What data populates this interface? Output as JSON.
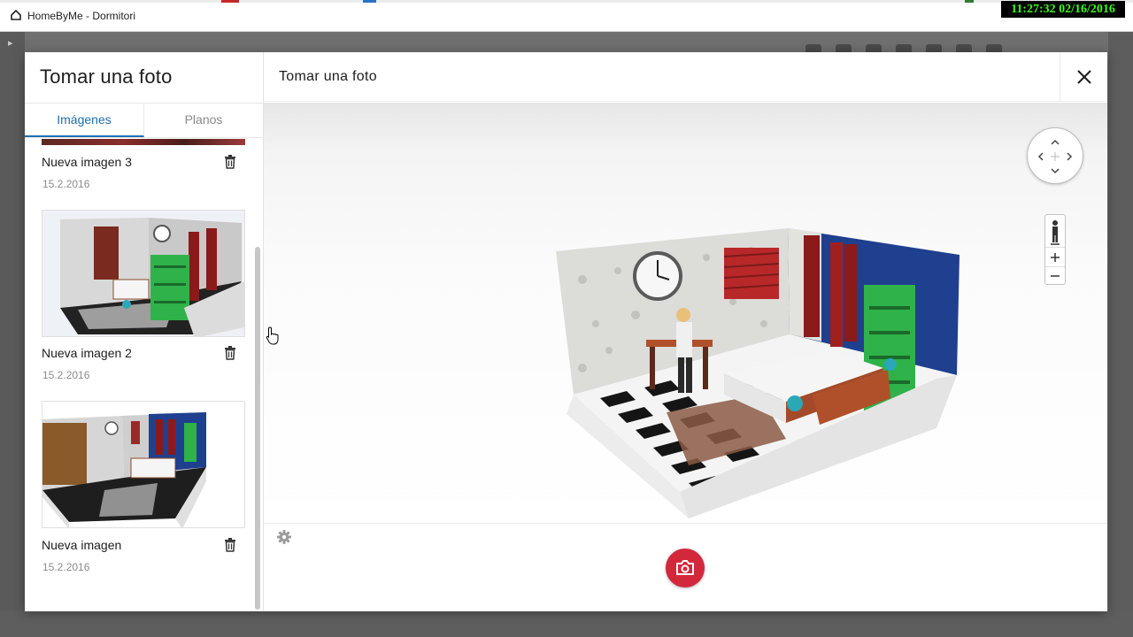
{
  "window": {
    "title": "HomeByMe - Dormitori",
    "clock": "11:27:32  02/16/2016"
  },
  "left_panel": {
    "title": "Tomar una foto",
    "tabs": [
      {
        "label": "Imágenes",
        "active": true
      },
      {
        "label": "Planos",
        "active": false
      }
    ],
    "images": [
      {
        "name": "Nueva imagen 3",
        "date": "15.2.2016"
      },
      {
        "name": "Nueva imagen 2",
        "date": "15.2.2016"
      },
      {
        "name": "Nueva imagen",
        "date": "15.2.2016"
      }
    ]
  },
  "viewer": {
    "title": "Tomar una foto",
    "close_icon": "close-icon",
    "settings_icon": "gear-icon",
    "capture_icon": "camera-icon"
  },
  "colors": {
    "accent": "#1f6fb0",
    "capture": "#d3283b",
    "wall_blue": "#1f3f8f",
    "shelf_green": "#2fb24a",
    "curtain_red": "#8b1a1a"
  }
}
